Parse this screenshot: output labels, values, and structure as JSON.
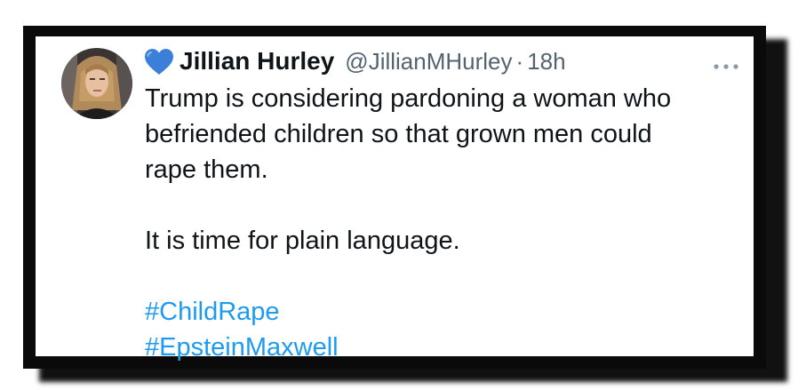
{
  "tweet": {
    "author": {
      "emoji_icon": "blue-heart-icon",
      "display_name": "Jillian Hurley",
      "handle": "@JillianMHurley",
      "separator": "·",
      "time": "18h"
    },
    "more_icon": "more-horizontal-icon",
    "lines": [
      "Trump is considering pardoning a woman who",
      "befriended children so that grown men could",
      "rape them."
    ],
    "paragraph2": "It is time for plain language.",
    "hashtags": [
      "#ChildRape",
      "#EpsteinMaxwell"
    ]
  },
  "colors": {
    "text": "#0f1419",
    "secondary": "#536471",
    "link": "#1d9bf0",
    "heart": "#3b7fd9",
    "frame": "#0a0a0a"
  }
}
